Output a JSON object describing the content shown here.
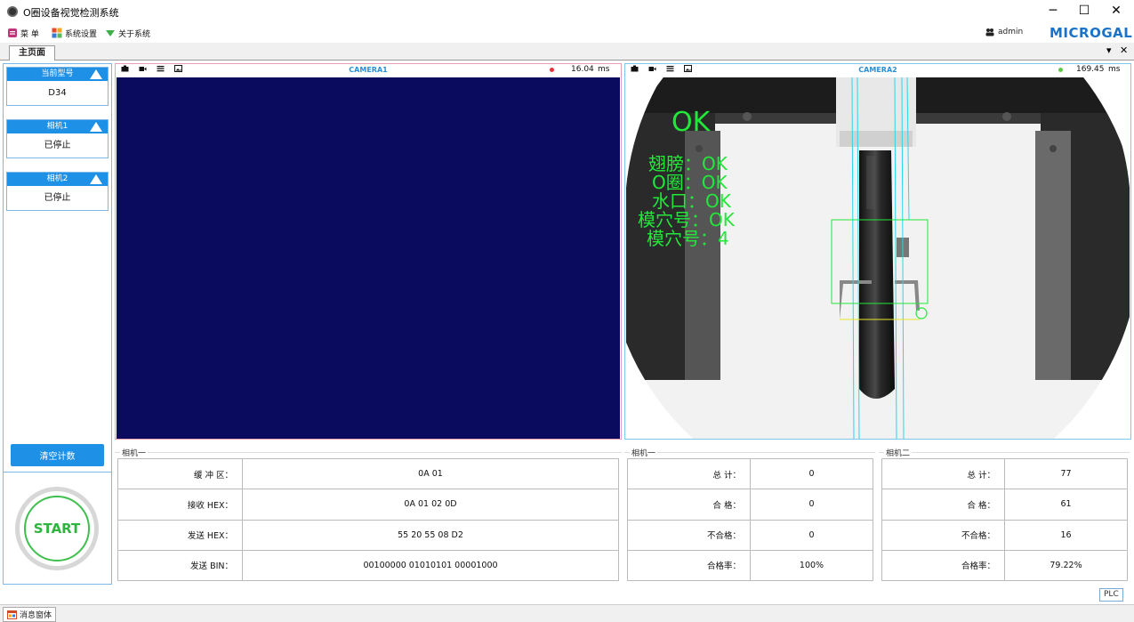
{
  "window": {
    "title": "O圈设备视觉检测系统",
    "min_label": "─",
    "max_label": "☐",
    "close_label": "✕"
  },
  "menu": {
    "items": [
      {
        "label": "菜 单",
        "icon": "menu-icon"
      },
      {
        "label": "系统设置",
        "icon": "settings-grid-icon"
      },
      {
        "label": "关于系统",
        "icon": "about-icon"
      }
    ]
  },
  "user": {
    "name": "admin",
    "icon": "user-group-icon"
  },
  "brand": {
    "logo_text": "MICROGAL"
  },
  "tabs": {
    "main": "主页面",
    "dropdown_label": "▾",
    "close_label": "✕"
  },
  "left": {
    "cards": [
      {
        "title": "当前型号",
        "value": "D34"
      },
      {
        "title": "相机1",
        "value": "已停止"
      },
      {
        "title": "相机2",
        "value": "已停止"
      }
    ],
    "clear_button": "清空计数",
    "start_button": "START"
  },
  "cameras": [
    {
      "title": "CAMERA1",
      "time": "16.04",
      "unit": "ms",
      "status_color": "#e8323c",
      "border_color": "#e8a0b4",
      "feed_color": "#0a0a5e"
    },
    {
      "title": "CAMERA2",
      "time": "169.45",
      "unit": "ms",
      "status_color": "#5ec846",
      "border_color": "#7cc8e8",
      "feed_color": "#1a1a1a"
    }
  ],
  "camera2_overlay": {
    "result": "OK",
    "lines": [
      "翅膀：OK",
      "O圈：OK",
      "水口：OK",
      "模穴号：OK",
      "模穴号：4"
    ],
    "overlay_color": "#22e83a"
  },
  "comm": {
    "group_title": "相机一",
    "rows": [
      {
        "label": "缓 冲 区：",
        "value": "0A 01"
      },
      {
        "label": "接收 HEX：",
        "value": "0A 01 02 0D"
      },
      {
        "label": "发送 HEX：",
        "value": "55 20 55 08 D2"
      },
      {
        "label": "发送 BIN：",
        "value": "00100000 01010101 00001000"
      }
    ]
  },
  "stats1": {
    "group_title": "相机一",
    "rows": [
      {
        "label": "总  计：",
        "value": "0"
      },
      {
        "label": "合  格：",
        "value": "0"
      },
      {
        "label": "不合格：",
        "value": "0"
      },
      {
        "label": "合格率：",
        "value": "100%"
      }
    ]
  },
  "stats2": {
    "group_title": "相机二",
    "rows": [
      {
        "label": "总  计：",
        "value": "77"
      },
      {
        "label": "合  格：",
        "value": "61"
      },
      {
        "label": "不合格：",
        "value": "16"
      },
      {
        "label": "合格率：",
        "value": "79.22%"
      }
    ]
  },
  "statusbar": {
    "message_tab": "消息窗体",
    "plc": "PLC"
  },
  "colors": {
    "accent": "#1e90e6",
    "start_green": "#2fb43f"
  }
}
